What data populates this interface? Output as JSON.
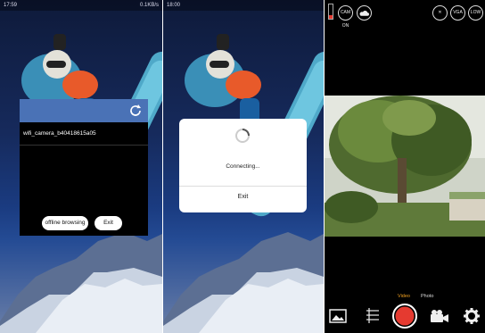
{
  "phone1": {
    "status_time": "17:59",
    "status_right": "0.1KB/s",
    "ssid": "wifi_camera_b40418615a05",
    "offline_label": "offline browsing",
    "exit_label": "Exit"
  },
  "phone2": {
    "status_time": "18:00",
    "connecting": "Connecting...",
    "exit_label": "Exit"
  },
  "camera": {
    "status_icon_left": "CAM ON",
    "mute_label": "✕",
    "resolution": "VGA",
    "rate": "LOW",
    "tabs": {
      "video": "Video",
      "photo": "Photo"
    },
    "accent": "#e53a30"
  }
}
